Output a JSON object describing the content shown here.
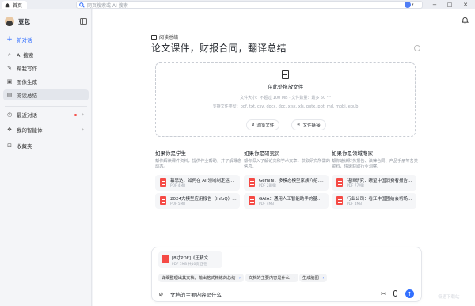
{
  "titlebar": {
    "tab_home": "首页",
    "search_placeholder": "网页搜索或 AI 搜索",
    "window_controls": [
      "−",
      "□",
      "✕"
    ]
  },
  "sidebar": {
    "user_name": "豆包",
    "items": [
      {
        "label": "新对话",
        "icon": "plus-icon"
      },
      {
        "label": "AI 搜索",
        "icon": "ai-search-icon"
      },
      {
        "label": "帮我写作",
        "icon": "pen-icon"
      },
      {
        "label": "图像生成",
        "icon": "image-icon"
      },
      {
        "label": "阅读总结",
        "icon": "book-icon",
        "selected": true
      }
    ],
    "sections": [
      {
        "label": "最近对话",
        "icon": "clock-icon"
      },
      {
        "label": "我的智能体",
        "icon": "agent-icon"
      },
      {
        "label": "收藏夹",
        "icon": "bookmark-icon"
      }
    ]
  },
  "main": {
    "kicker": "阅读总结",
    "headline": "论文课件，财报合同，翻译总结",
    "dropzone": {
      "title": "在此处拖放文件",
      "limits": "文件大小：不超过 100 MB · 文件数量：最多 50 个",
      "formats": "支持文件类型：pdf, txt, csv, docx, doc, xlsx, xls, pptx, ppt, md, mobi, epub",
      "browse_label": "浏览文件",
      "link_label": "文件链接"
    },
    "columns": [
      {
        "title": "如果你是学生",
        "desc": "帮你解读课件资料，提供作业帮助，并了解概念动态。",
        "files": [
          {
            "name": "幕思达：如何在 AI 领域制定运营创新…",
            "size": "PDF 4MB"
          },
          {
            "name": "2024大模型应用报告（InfoQ）.pdf",
            "size": "PDF 5MB"
          }
        ]
      },
      {
        "title": "如果你是研究员",
        "desc": "帮你深入了解论文和学术文章，获取研究所需的信息。",
        "files": [
          {
            "name": "Gemini：多模态模型家族介绍.pdf",
            "size": "PDF 28MB"
          },
          {
            "name": "GAIA：通用人工智能助手的基准.pdf",
            "size": "PDF 4MB"
          }
        ]
      },
      {
        "title": "如果你是领域专家",
        "desc": "帮你速读财务报告、法律合同、产品手册等各类资料，快速获取行业洞察。",
        "files": [
          {
            "name": "铭恒研究：瞭望中国消费者报告…",
            "size": "PDF 77MB"
          },
          {
            "name": "行业公司：看江中国团结会切场策略…",
            "size": "PDF 4MB"
          }
        ]
      }
    ]
  },
  "composer": {
    "attachment": {
      "name": "[8寸PDF]《王精文…",
      "meta": "PDF 1MB 共10页 正在"
    },
    "suggestions": [
      {
        "label": "详细整理出其文档，输出格式精炼的总结"
      },
      {
        "label": "文档的主要内容是什么"
      },
      {
        "label": "生成脑图"
      }
    ],
    "input_value": "文档的主要内容是什么",
    "input_placeholder": "文档的主要内容是什么"
  },
  "watermark": "极速下载站",
  "colors": {
    "accent": "#3370ff",
    "pdf": "#f54a45",
    "sidebar_bg": "#f4f5f8"
  }
}
